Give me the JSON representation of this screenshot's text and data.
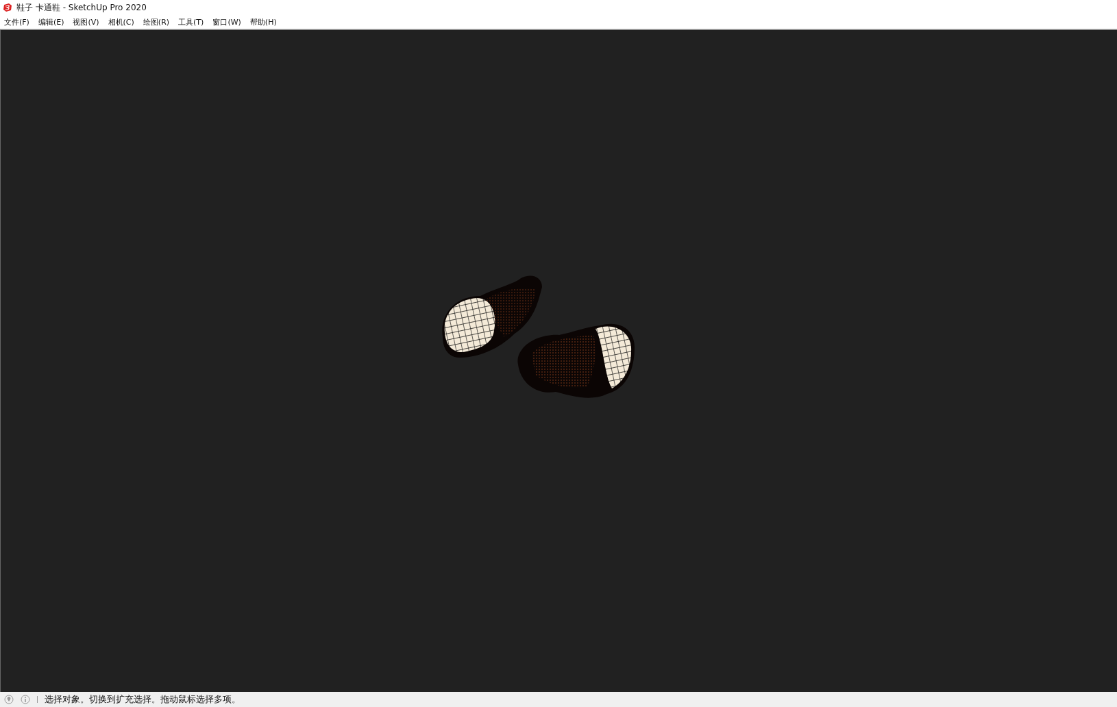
{
  "window": {
    "title": "鞋子 卡通鞋 - SketchUp Pro 2020"
  },
  "menu": [
    {
      "label": "文件(F)"
    },
    {
      "label": "编辑(E)"
    },
    {
      "label": "视图(V)"
    },
    {
      "label": "相机(C)"
    },
    {
      "label": "绘图(R)"
    },
    {
      "label": "工具(T)"
    },
    {
      "label": "窗口(W)"
    },
    {
      "label": "帮助(H)"
    }
  ],
  "status_bar": {
    "message": "选择对象。切换到扩充选择。拖动鼠标选择多项。"
  }
}
